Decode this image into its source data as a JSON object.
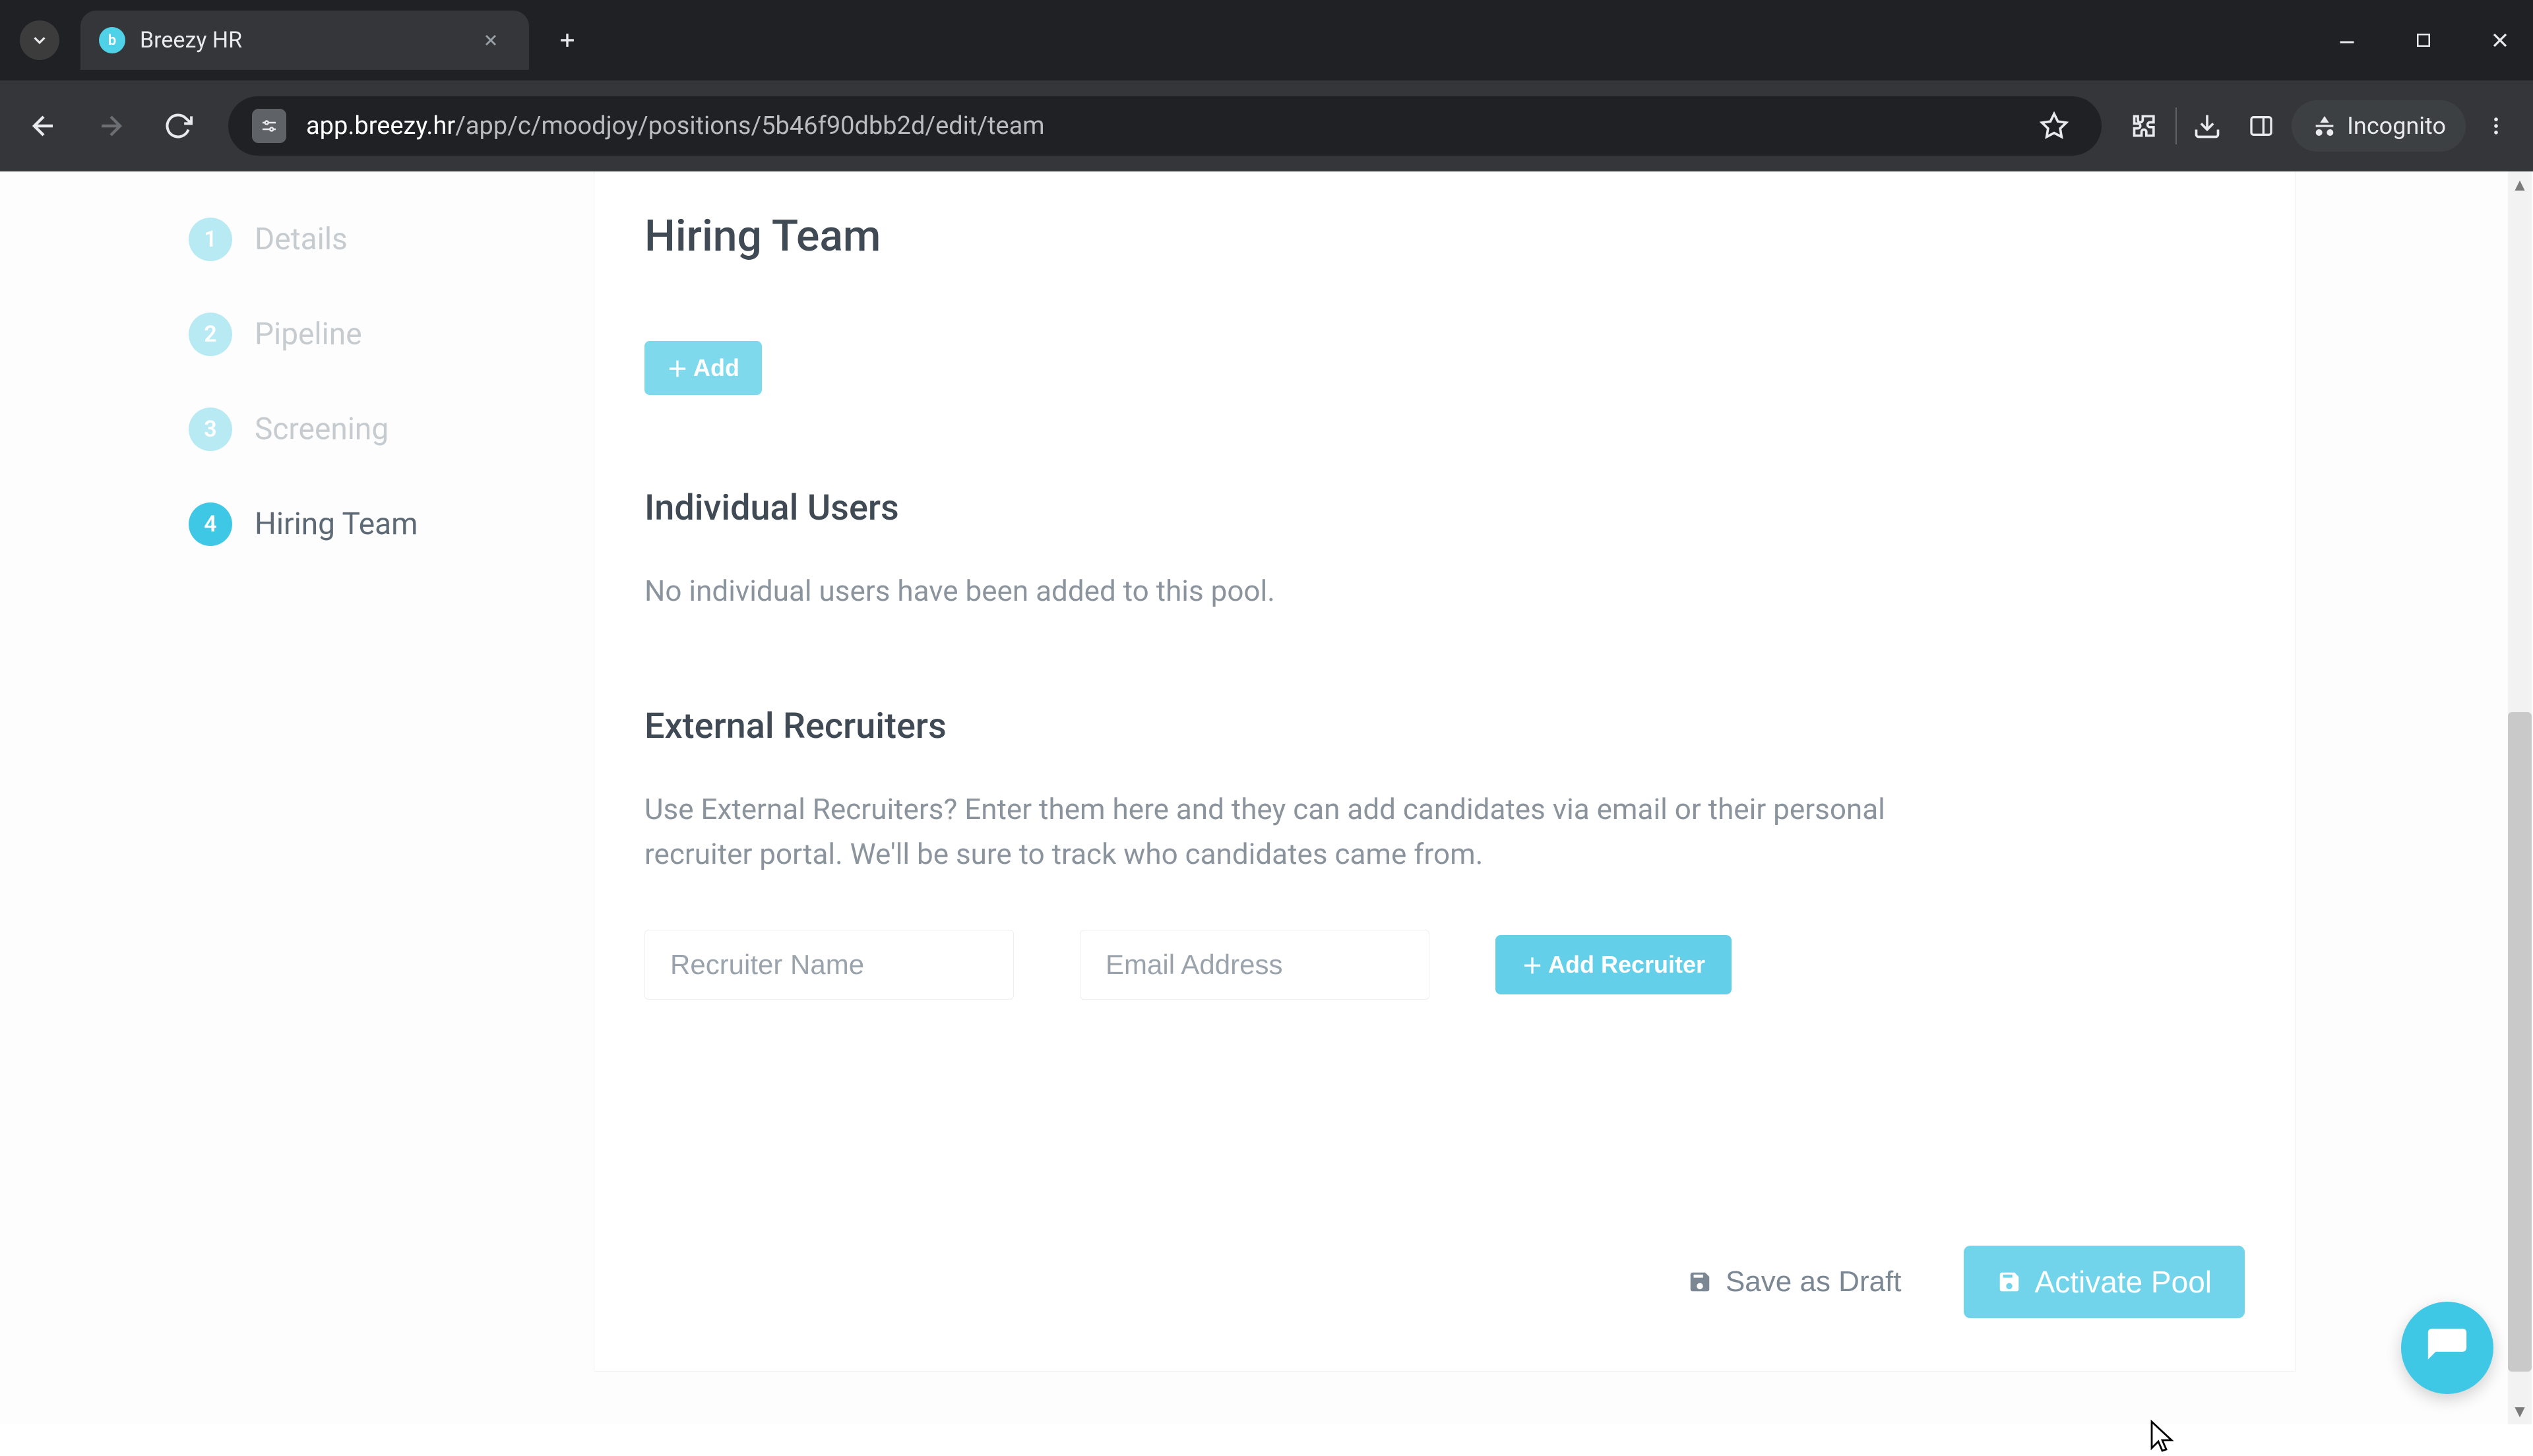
{
  "browser": {
    "tab_title": "Breezy HR",
    "url_host": "app.breezy.hr",
    "url_path": "/app/c/moodjoy/positions/5b46f90dbb2d/edit/team",
    "incognito_label": "Incognito"
  },
  "sidebar": {
    "steps": [
      {
        "num": "1",
        "label": "Details"
      },
      {
        "num": "2",
        "label": "Pipeline"
      },
      {
        "num": "3",
        "label": "Screening"
      },
      {
        "num": "4",
        "label": "Hiring Team"
      }
    ],
    "active_index": 3
  },
  "page": {
    "title": "Hiring Team",
    "add_button": "Add",
    "individual_users": {
      "title": "Individual Users",
      "empty_text": "No individual users have been added to this pool."
    },
    "external_recruiters": {
      "title": "External Recruiters",
      "description": "Use External Recruiters? Enter them here and they can add candidates via email or their personal recruiter portal. We'll be sure to track who candidates came from.",
      "name_placeholder": "Recruiter Name",
      "email_placeholder": "Email Address",
      "add_recruiter_button": "Add Recruiter"
    },
    "footer": {
      "save_draft": "Save as Draft",
      "activate": "Activate Pool"
    }
  },
  "colors": {
    "accent": "#3ec8e6"
  }
}
